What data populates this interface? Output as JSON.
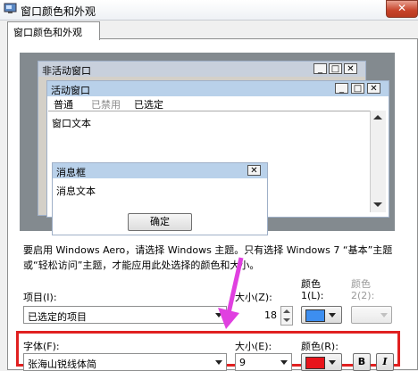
{
  "window": {
    "title": "窗口颜色和外观",
    "close_symbol": "✕"
  },
  "tab": {
    "label": "窗口颜色和外观"
  },
  "preview": {
    "inactive_title": "非活动窗口",
    "active_title": "活动窗口",
    "menu": [
      "普通",
      "已禁用",
      "已选定"
    ],
    "window_text": "窗口文本",
    "msgbox_title": "消息框",
    "msgbox_text": "消息文本",
    "ok_label": "确定"
  },
  "description": "要启用 Windows Aero，请选择 Windows 主题。只有选择 Windows 7 “基本”主题或“轻松访问”主题，才能应用此处选择的颜色和大小。",
  "item": {
    "label": "项目(I):",
    "value": "已选定的项目",
    "size_label": "大小(Z):",
    "size_value": "18",
    "color1_header": "颜色",
    "color1_label": "1(L):",
    "color2_header": "颜色",
    "color2_label": "2(2):",
    "color1": "#3d8ef0"
  },
  "font": {
    "label": "字体(F):",
    "value": "张海山锐线体简",
    "size_label": "大小(E):",
    "size_value": "9",
    "color_label": "颜色(R):",
    "color": "#e8141b",
    "bold_label": "B",
    "italic_label": "I"
  },
  "colors": {
    "highlight_frame": "#e02020",
    "annotation_arrow": "#e040e0",
    "preview_bg": "#838a8f"
  }
}
